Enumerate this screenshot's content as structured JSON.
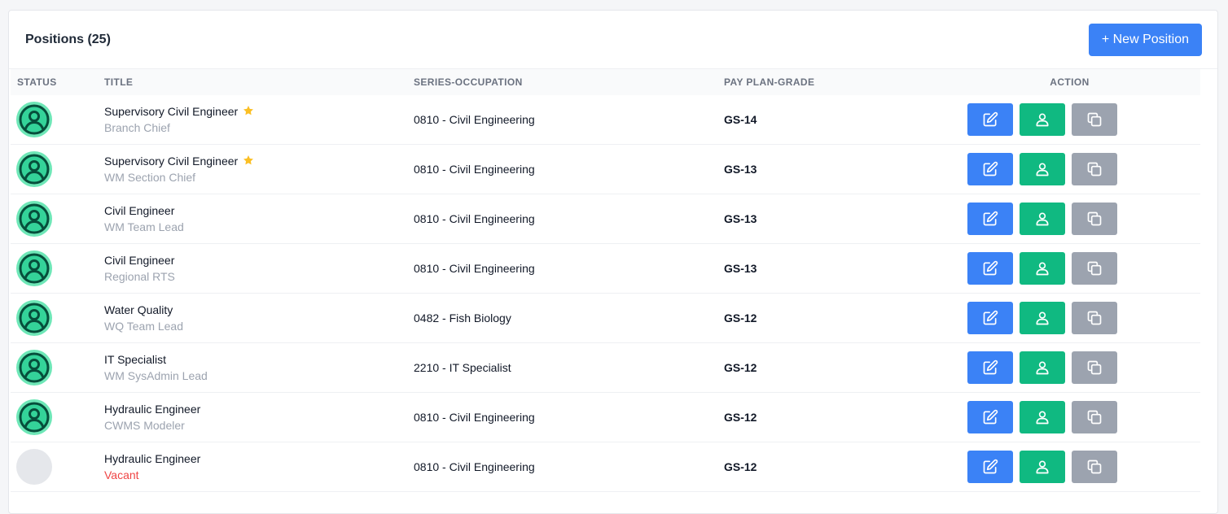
{
  "header": {
    "title": "Positions (25)",
    "new_button_label": "+ New Position",
    "accent_color": "#3b82f6"
  },
  "columns": {
    "status": "STATUS",
    "title": "TITLE",
    "series": "SERIES-OCCUPATION",
    "grade": "PAY PLAN-GRADE",
    "action": "ACTION"
  },
  "rows": [
    {
      "title": "Supervisory Civil Engineer",
      "starred": true,
      "subtitle": "Branch Chief",
      "series": "0810 - Civil Engineering",
      "grade": "GS-14",
      "status": "filled"
    },
    {
      "title": "Supervisory Civil Engineer",
      "starred": true,
      "subtitle": "WM Section Chief",
      "series": "0810 - Civil Engineering",
      "grade": "GS-13",
      "status": "filled"
    },
    {
      "title": "Civil Engineer",
      "starred": false,
      "subtitle": "WM Team Lead",
      "series": "0810 - Civil Engineering",
      "grade": "GS-13",
      "status": "filled"
    },
    {
      "title": "Civil Engineer",
      "starred": false,
      "subtitle": "Regional RTS",
      "series": "0810 - Civil Engineering",
      "grade": "GS-13",
      "status": "filled"
    },
    {
      "title": "Water Quality",
      "starred": false,
      "subtitle": "WQ Team Lead",
      "series": "0482 - Fish Biology",
      "grade": "GS-12",
      "status": "filled"
    },
    {
      "title": "IT Specialist",
      "starred": false,
      "subtitle": "WM SysAdmin Lead",
      "series": "2210 - IT Specialist",
      "grade": "GS-12",
      "status": "filled"
    },
    {
      "title": "Hydraulic Engineer",
      "starred": false,
      "subtitle": "CWMS Modeler",
      "series": "0810 - Civil Engineering",
      "grade": "GS-12",
      "status": "filled"
    },
    {
      "title": "Hydraulic Engineer",
      "starred": false,
      "subtitle": "Vacant",
      "series": "0810 - Civil Engineering",
      "grade": "GS-12",
      "status": "vacant"
    }
  ],
  "icons": {
    "status_filled": "user-circle-icon",
    "status_vacant": "empty-avatar",
    "star": "star-icon",
    "edit": "edit-icon",
    "assign": "user-icon",
    "copy": "copy-icon"
  },
  "colors": {
    "filled_status": "#6ee7b7",
    "vacant_text": "#ef4444",
    "edit_button": "#3b82f6",
    "assign_button": "#10b981",
    "copy_button": "#9ca3af",
    "star": "#fbbf24"
  }
}
